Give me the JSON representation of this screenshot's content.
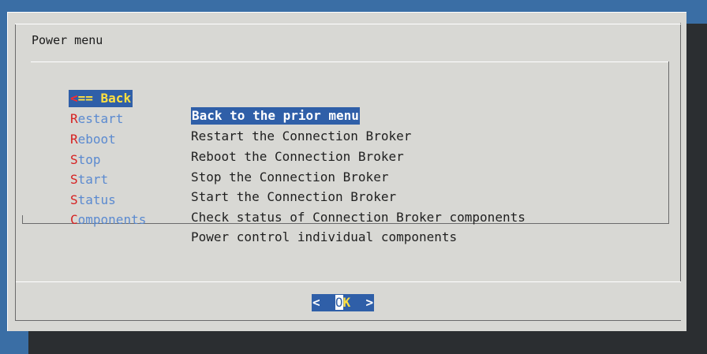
{
  "dialog": {
    "title": "Power menu",
    "menu": [
      {
        "hot": "<",
        "rest": "== Back",
        "desc": "Back to the prior menu",
        "selected": true
      },
      {
        "hot": "R",
        "rest": "estart",
        "desc": "Restart the Connection Broker",
        "selected": false
      },
      {
        "hot": "R",
        "rest": "eboot",
        "desc": "Reboot the Connection Broker",
        "selected": false
      },
      {
        "hot": "S",
        "rest": "top",
        "desc": "Stop the Connection Broker",
        "selected": false
      },
      {
        "hot": "S",
        "rest": "tart",
        "desc": "Start the Connection Broker",
        "selected": false
      },
      {
        "hot": "S",
        "rest": "tatus",
        "desc": "Check status of Connection Broker components",
        "selected": false
      },
      {
        "hot": "C",
        "rest": "omponents",
        "desc": "Power control individual components",
        "selected": false
      }
    ],
    "ok_button": {
      "left": "<  ",
      "o": "O",
      "k": "K",
      "right": "  >"
    }
  },
  "colors": {
    "background": "#3a6ea5",
    "dialog": "#d8d8d4",
    "selection": "#2f5fa8",
    "hotkey": "#d62020",
    "tag_text": "#5b8ad0",
    "highlight_text": "#ffe040"
  }
}
